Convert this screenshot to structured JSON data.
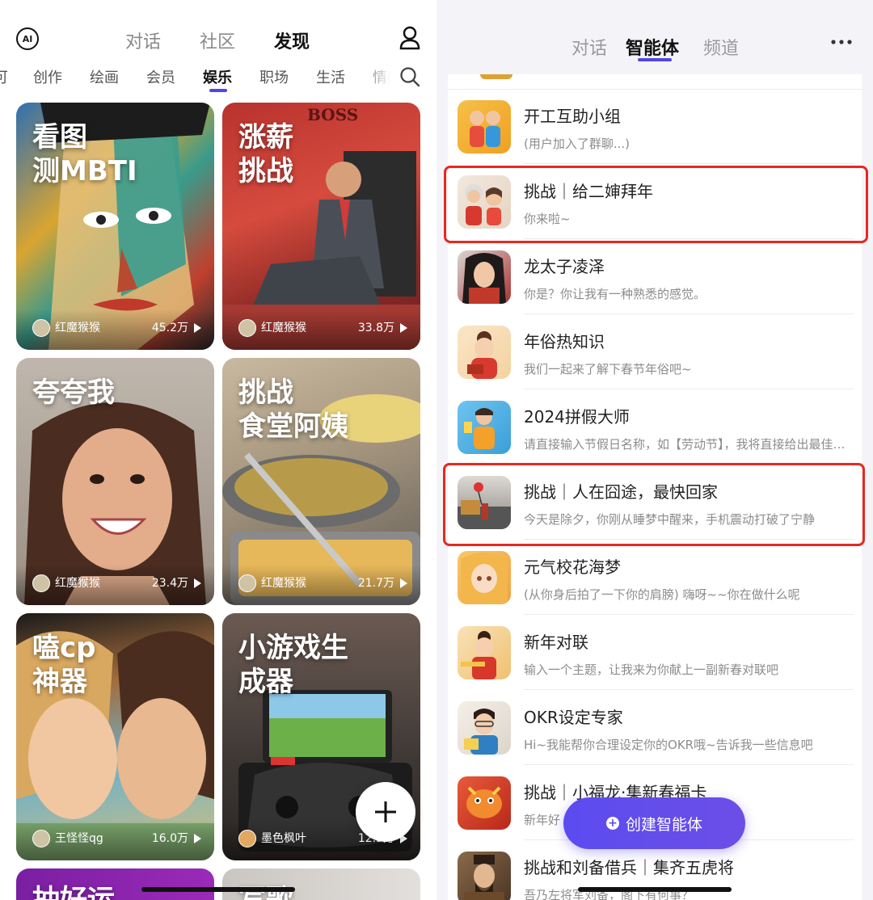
{
  "left": {
    "top_tabs": [
      "对话",
      "社区",
      "发现"
    ],
    "active_top_tab": "发现",
    "logo_text": "AI",
    "categories": [
      "可",
      "创作",
      "绘画",
      "会员",
      "娱乐",
      "职场",
      "生活",
      "情感"
    ],
    "active_category": "娱乐",
    "cards": [
      {
        "title": "看图\n测MBTI",
        "author": "红魔猴猴",
        "count": "45.2万"
      },
      {
        "title": "涨薪\n挑战",
        "author": "红魔猴猴",
        "count": "33.8万",
        "image_text": "BOSS"
      },
      {
        "title": "夸夸我",
        "author": "红魔猴猴",
        "count": "23.4万"
      },
      {
        "title": "挑战\n食堂阿姨",
        "author": "红魔猴猴",
        "count": "21.7万"
      },
      {
        "title": "嗑cp\n神器",
        "author": "王怪怪qg",
        "count": "16.0万"
      },
      {
        "title": "小游戏生\n成器",
        "author": "墨色枫叶",
        "count": "12.5万"
      },
      {
        "title": "抽好运",
        "author": "",
        "count": ""
      },
      {
        "title": "写歌",
        "author": "",
        "count": ""
      }
    ]
  },
  "right": {
    "tabs": [
      "对话",
      "智能体",
      "频道"
    ],
    "active_tab": "智能体",
    "items": [
      {
        "title": "开工互助小组",
        "subtitle": "(用户加入了群聊...)",
        "highlighted": false
      },
      {
        "title": "挑战｜给二婶拜年",
        "subtitle": "你来啦~",
        "highlighted": true
      },
      {
        "title": "龙太子凌泽",
        "subtitle": "你是？你让我有一种熟悉的感觉。",
        "highlighted": false
      },
      {
        "title": "年俗热知识",
        "subtitle": "我们一起来了解下春节年俗吧~",
        "highlighted": false
      },
      {
        "title": "2024拼假大师",
        "subtitle": "请直接输入节假日名称，如【劳动节】，我将直接给出最佳拼假方案",
        "highlighted": false
      },
      {
        "title": "挑战｜人在囧途，最快回家",
        "subtitle": "今天是除夕，你刚从睡梦中醒来，手机震动打破了宁静",
        "highlighted": true
      },
      {
        "title": "元气校花海梦",
        "subtitle": "(从你身后拍了一下你的肩膀) 嗨呀~~你在做什么呢",
        "highlighted": false
      },
      {
        "title": "新年对联",
        "subtitle": "输入一个主题，让我来为你献上一副新春对联吧",
        "highlighted": false
      },
      {
        "title": "OKR设定专家",
        "subtitle": "Hi~我能帮你合理设定你的OKR哦~告诉我一些信息吧",
        "highlighted": false
      },
      {
        "title": "挑战｜小福龙·集新春福卡",
        "subtitle": "新年好                                 的\"福气卡\"，...",
        "highlighted": false
      },
      {
        "title": "挑战和刘备借兵｜集齐五虎将",
        "subtitle": "吾乃左将军刘备，阁下有何事？",
        "highlighted": false
      }
    ],
    "create_button": "创建智能体"
  },
  "colors": {
    "accent": "#4f46e5",
    "highlight_border": "#e8281e",
    "create_button": "#5b4cf0"
  }
}
